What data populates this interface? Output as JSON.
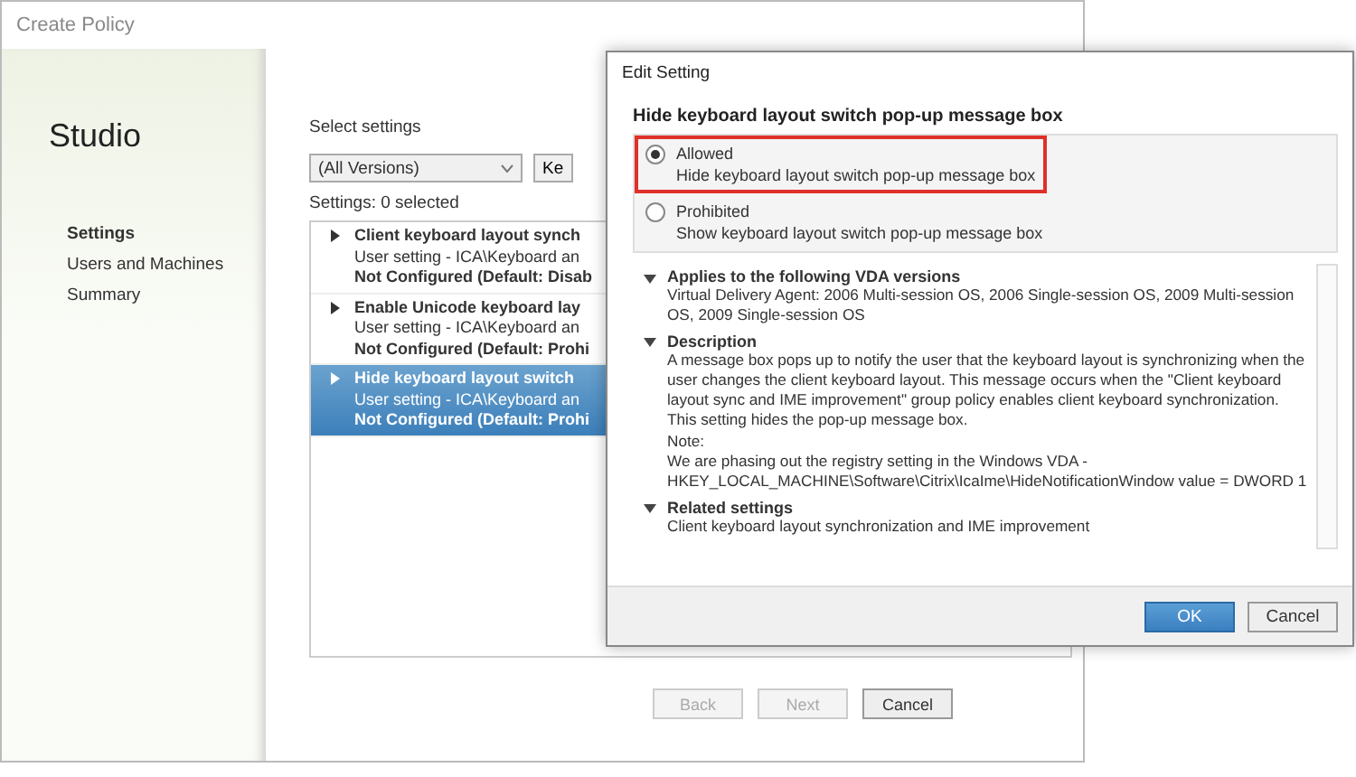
{
  "back_window": {
    "title": "Create Policy",
    "brand": "Studio",
    "nav": [
      {
        "label": "Settings",
        "selected": true
      },
      {
        "label": "Users and Machines",
        "selected": false
      },
      {
        "label": "Summary",
        "selected": false
      }
    ],
    "heading": "Select settings",
    "version_dropdown": "(All Versions)",
    "search_button": "Ke",
    "count": "Settings: 0 selected",
    "settings": [
      {
        "name": "Client keyboard layout synch",
        "path": "User setting - ICA\\Keyboard an",
        "state": "Not Configured (Default: Disab",
        "selected": false
      },
      {
        "name": "Enable Unicode keyboard lay",
        "path": "User setting - ICA\\Keyboard an",
        "state": "Not Configured (Default: Prohi",
        "selected": false
      },
      {
        "name": "Hide keyboard layout switch",
        "path": "User setting - ICA\\Keyboard an",
        "state": "Not Configured (Default: Prohi",
        "selected": true
      }
    ],
    "buttons": [
      {
        "label": "Back",
        "disabled": true
      },
      {
        "label": "Next",
        "disabled": true
      },
      {
        "label": "Cancel",
        "disabled": false
      }
    ]
  },
  "dialog": {
    "title": "Edit Setting",
    "heading": "Hide keyboard layout switch pop-up message box",
    "options": [
      {
        "label": "Allowed",
        "description": "Hide keyboard layout switch pop-up message box",
        "selected": true,
        "highlighted": true
      },
      {
        "label": "Prohibited",
        "description": "Show keyboard layout switch pop-up message box",
        "selected": false,
        "highlighted": false
      }
    ],
    "sections": [
      {
        "title": "Applies to the following VDA versions",
        "expanded": true,
        "lines": [
          "Virtual Delivery Agent: 2006 Multi-session OS, 2006 Single-session OS, 2009 Multi-session OS, 2009 Single-session OS"
        ]
      },
      {
        "title": "Description",
        "expanded": true,
        "lines": [
          "A message box pops up to notify the user that the keyboard layout is synchronizing when the user changes the client keyboard layout. This message occurs when the \"Client keyboard layout sync and IME improvement\" group policy enables client keyboard synchronization. This setting hides the pop-up message box.",
          "Note:",
          "We are phasing out the registry setting in the Windows VDA - HKEY_LOCAL_MACHINE\\Software\\Citrix\\IcaIme\\HideNotificationWindow value = DWORD 1"
        ]
      },
      {
        "title": "Related settings",
        "expanded": true,
        "lines": [
          "Client keyboard layout synchronization and IME improvement"
        ]
      }
    ],
    "buttons": [
      {
        "label": "OK",
        "primary": true
      },
      {
        "label": "Cancel",
        "primary": false
      }
    ]
  }
}
